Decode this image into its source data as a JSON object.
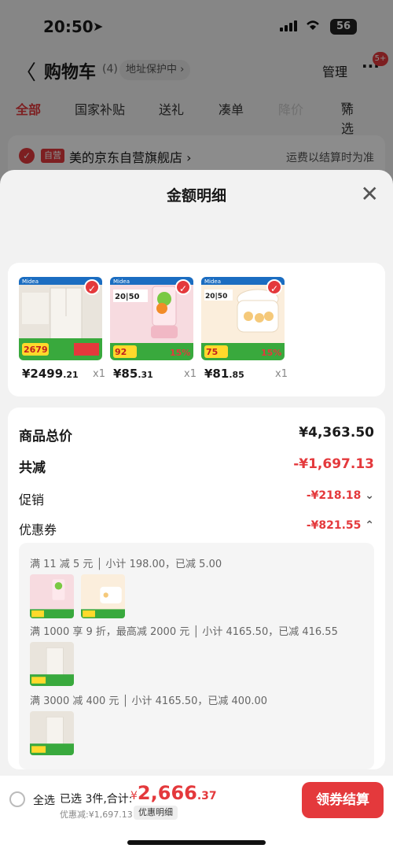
{
  "status_bar": {
    "time": "20:50",
    "battery": "56"
  },
  "nav": {
    "back": "〈",
    "title": "购物车",
    "count": "(4)",
    "protect": "地址保护中",
    "manage": "管理",
    "more": "···",
    "badge": "5+"
  },
  "tabs": [
    {
      "label": "全部",
      "state": "active"
    },
    {
      "label": "国家补贴",
      "state": "normal"
    },
    {
      "label": "送礼",
      "state": "normal"
    },
    {
      "label": "凑单",
      "state": "normal"
    },
    {
      "label": "降价",
      "state": "disabled"
    },
    {
      "label": "筛选",
      "state": "normal"
    }
  ],
  "store": {
    "tag": "自营",
    "name": "美的京东自营旗舰店 ›",
    "shipping": "运费以结算时为准"
  },
  "sheet": {
    "title": "金额明细",
    "close": "✕"
  },
  "products": [
    {
      "id": "fridge",
      "price_int": "¥2499",
      "price_dec": ".21",
      "qty": "x1"
    },
    {
      "id": "blender",
      "price_int": "¥85",
      "price_dec": ".31",
      "qty": "x1"
    },
    {
      "id": "steamer",
      "price_int": "¥81",
      "price_dec": ".85",
      "qty": "x1"
    }
  ],
  "summary": {
    "total_label": "商品总价",
    "total_value": "¥4,363.50",
    "reduce_label": "共减",
    "reduce_value": "-¥1,697.13",
    "promo_label": "促销",
    "promo_value": "-¥218.18",
    "coupon_label": "优惠券",
    "coupon_value": "-¥821.55"
  },
  "coupon_groups": [
    {
      "text": "满 11 减 5 元 │ 小计 198.00，已减 5.00",
      "items": [
        "blender",
        "steamer"
      ]
    },
    {
      "text": "满 1000 享 9 折，最高减 2000 元 │ 小计 4165.50，已减 416.55",
      "items": [
        "fridge"
      ]
    },
    {
      "text": "满 3000 减 400 元 │ 小计 4165.50，已减 400.00",
      "items": [
        "fridge"
      ]
    }
  ],
  "footer": {
    "select_all": "全选",
    "selected": "已选 3件,合计:",
    "currency": "¥",
    "total_int": "2,666",
    "total_dec": ".37",
    "discount": "优惠减:¥1,697.13",
    "detail": "优惠明细",
    "checkout": "领券结算"
  },
  "colors": {
    "accent": "#e4393c"
  }
}
